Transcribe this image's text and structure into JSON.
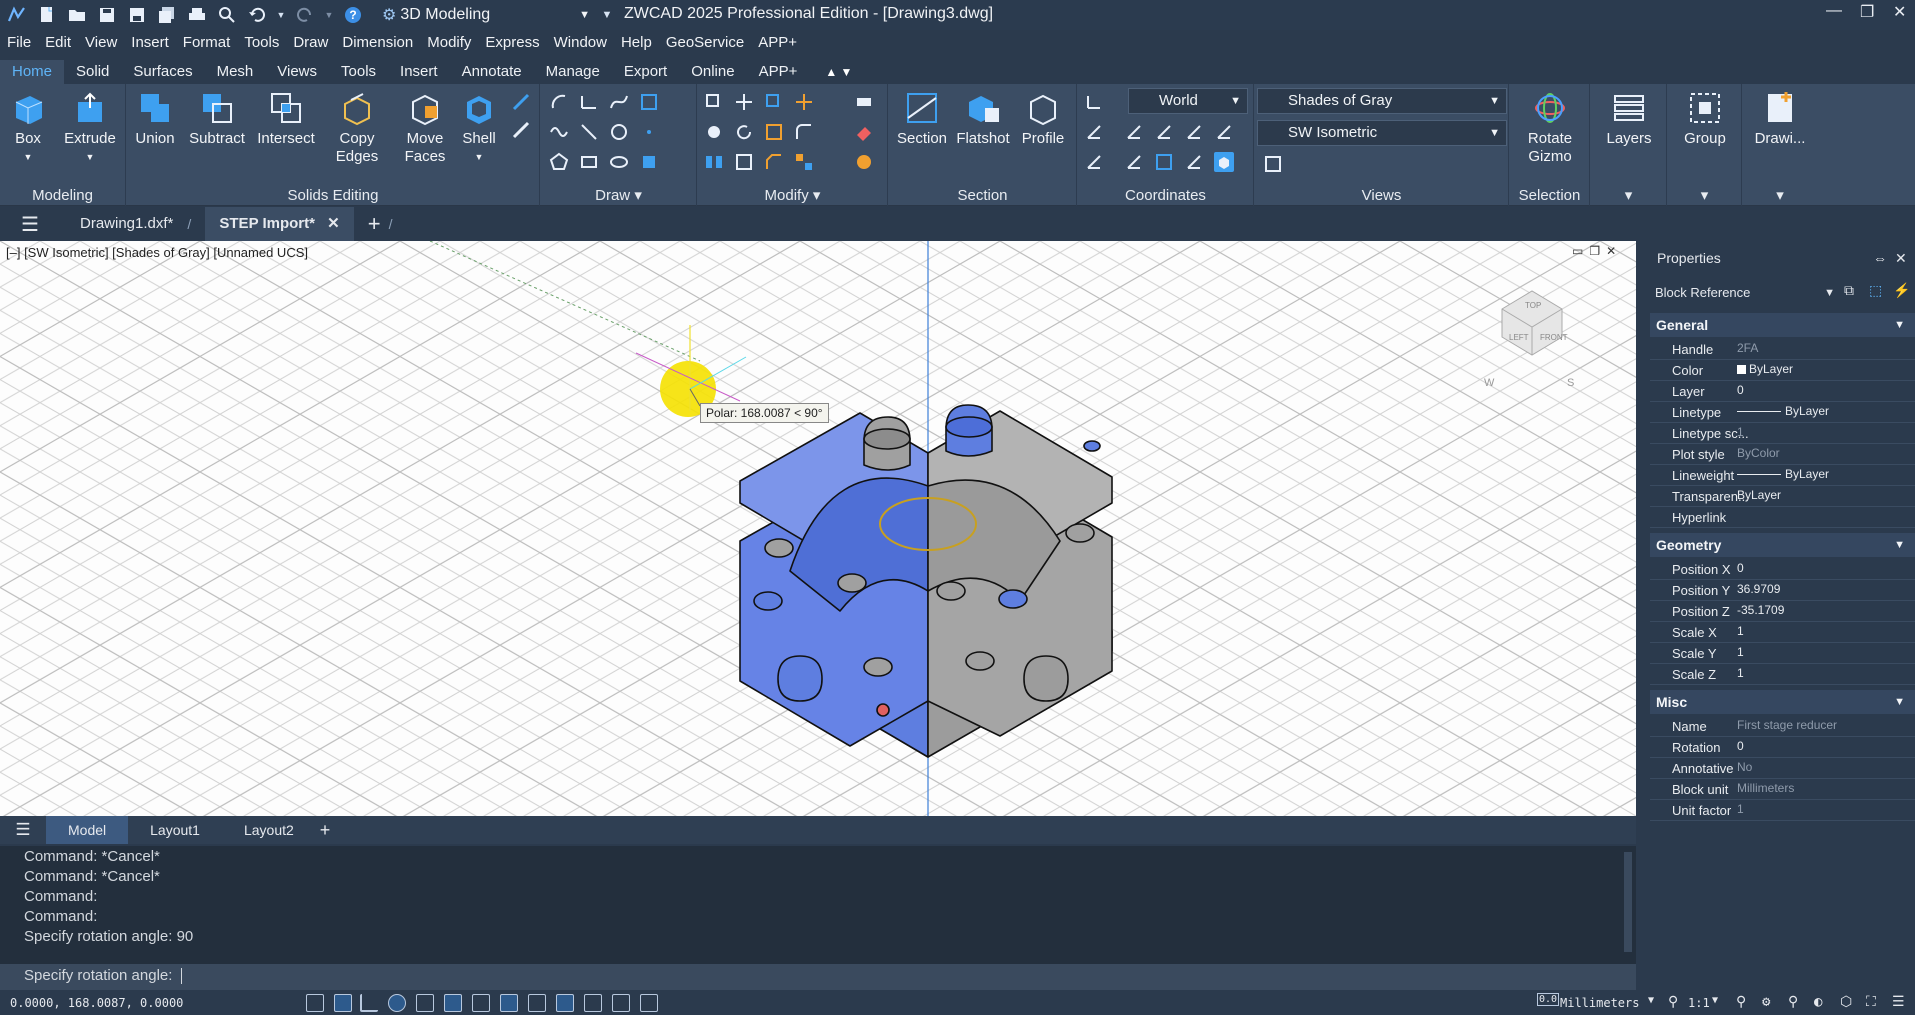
{
  "app": {
    "title": "ZWCAD 2025 Professional Edition - [Drawing3.dwg]",
    "workspace": "3D Modeling"
  },
  "menu": [
    "File",
    "Edit",
    "View",
    "Insert",
    "Format",
    "Tools",
    "Draw",
    "Dimension",
    "Modify",
    "Express",
    "Window",
    "Help",
    "GeoService",
    "APP+"
  ],
  "ribbon_tabs": [
    "Home",
    "Solid",
    "Surfaces",
    "Mesh",
    "Views",
    "Tools",
    "Insert",
    "Annotate",
    "Manage",
    "Export",
    "Online",
    "APP+"
  ],
  "ribbon": {
    "modeling": {
      "title": "Modeling",
      "box": "Box",
      "extrude": "Extrude"
    },
    "solids_editing": {
      "title": "Solids Editing",
      "union": "Union",
      "subtract": "Subtract",
      "intersect": "Intersect",
      "copy_edges_1": "Copy",
      "copy_edges_2": "Edges",
      "move_faces_1": "Move",
      "move_faces_2": "Faces",
      "shell": "Shell"
    },
    "draw": {
      "title": "Draw"
    },
    "modify": {
      "title": "Modify"
    },
    "section": {
      "title": "Section",
      "section": "Section",
      "flatshot": "Flatshot",
      "profile": "Profile"
    },
    "coordinates": {
      "title": "Coordinates",
      "ucs": "World"
    },
    "views": {
      "title": "Views",
      "visual_style": "Shades of Gray",
      "view": "SW Isometric"
    },
    "selection": {
      "title": "Selection",
      "rotate_1": "Rotate",
      "rotate_2": "Gizmo"
    },
    "layers": "Layers",
    "group": "Group",
    "drawing": "Drawi..."
  },
  "doc_tabs": [
    "Drawing1.dxf*",
    "STEP Import*"
  ],
  "viewport": {
    "label": "[–] [SW Isometric] [Shades of Gray] [Unnamed UCS]",
    "tooltip": "Polar: 168.0087 < 90°",
    "cube_labels": [
      "TOP",
      "LEFT",
      "FRONT",
      "W",
      "S"
    ]
  },
  "layout_tabs": [
    "Model",
    "Layout1",
    "Layout2"
  ],
  "command_history": [
    "Command: *Cancel*",
    "Command: *Cancel*",
    "Command:",
    "Command:",
    "Specify rotation angle: 90"
  ],
  "command_prompt": "Specify rotation angle:",
  "status": {
    "coords": "0.0000, 168.0087, 0.0000",
    "units": "Millimeters",
    "scale": "1:1"
  },
  "properties": {
    "title": "Properties",
    "selection": "Block Reference",
    "general": {
      "title": "General",
      "rows": [
        {
          "k": "Handle",
          "v": "2FA"
        },
        {
          "k": "Color",
          "v": "ByLayer"
        },
        {
          "k": "Layer",
          "v": "0"
        },
        {
          "k": "Linetype",
          "v": "ByLayer"
        },
        {
          "k": "Linetype sc...",
          "v": "1"
        },
        {
          "k": "Plot style",
          "v": "ByColor"
        },
        {
          "k": "Lineweight",
          "v": "ByLayer"
        },
        {
          "k": "Transparen...",
          "v": "ByLayer"
        },
        {
          "k": "Hyperlink",
          "v": ""
        }
      ]
    },
    "geometry": {
      "title": "Geometry",
      "rows": [
        {
          "k": "Position X",
          "v": "0"
        },
        {
          "k": "Position Y",
          "v": "36.9709"
        },
        {
          "k": "Position Z",
          "v": "-35.1709"
        },
        {
          "k": "Scale X",
          "v": "1"
        },
        {
          "k": "Scale Y",
          "v": "1"
        },
        {
          "k": "Scale Z",
          "v": "1"
        }
      ]
    },
    "misc": {
      "title": "Misc",
      "rows": [
        {
          "k": "Name",
          "v": "First stage reducer"
        },
        {
          "k": "Rotation",
          "v": "0"
        },
        {
          "k": "Annotative",
          "v": "No"
        },
        {
          "k": "Block unit",
          "v": "Millimeters"
        },
        {
          "k": "Unit factor",
          "v": "1"
        }
      ]
    }
  },
  "colors": {
    "accent": "#5fb4f7",
    "model_blue": "#5e7ee0",
    "model_gray": "#9c9c9c"
  }
}
